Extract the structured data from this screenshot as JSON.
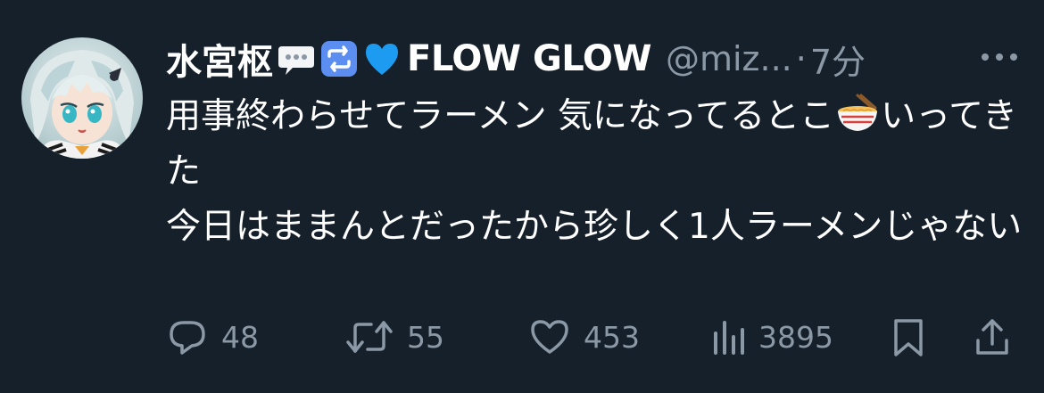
{
  "tweet": {
    "display_name_prefix": "水宮枢",
    "display_name_suffix": "FLOW GLOW",
    "name_emojis": [
      "speech-bubble-emoji",
      "repeat-button-emoji",
      "blue-heart-emoji"
    ],
    "handle": "@miz...",
    "separator": "·",
    "time": "7分",
    "text_part1": "用事終わらせてラーメン 気になってるとこ",
    "text_part2": "いってきた\n今日はままんとだったから珍しく1人ラーメンじゃない",
    "inline_emoji": "ramen-emoji"
  },
  "actions": {
    "replies": "48",
    "retweets": "55",
    "likes": "453",
    "views": "3895"
  },
  "colors": {
    "background": "#15202b",
    "text": "#ffffff",
    "muted": "#8b98a5",
    "blue_heart": "#1d9bf0"
  }
}
